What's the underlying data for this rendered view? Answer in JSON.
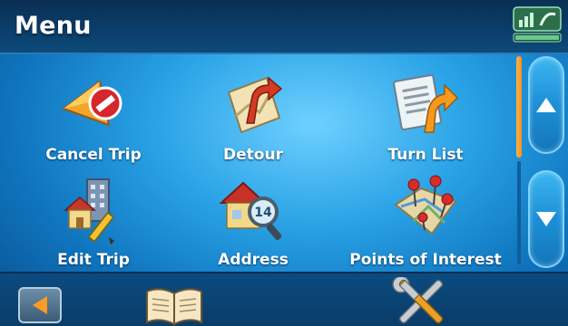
{
  "header": {
    "title": "Menu"
  },
  "menu": {
    "items": [
      {
        "label": "Cancel Trip",
        "icon": "cancel-trip-icon"
      },
      {
        "label": "Detour",
        "icon": "detour-icon"
      },
      {
        "label": "Turn List",
        "icon": "turn-list-icon"
      },
      {
        "label": "Edit Trip",
        "icon": "edit-trip-icon"
      },
      {
        "label": "Address",
        "icon": "address-icon"
      },
      {
        "label": "Points of Interest",
        "icon": "points-of-interest-icon"
      }
    ]
  },
  "colors": {
    "accent": "#ff8f1e",
    "background": "#2aa3e6",
    "header": "#0b3d6a"
  }
}
